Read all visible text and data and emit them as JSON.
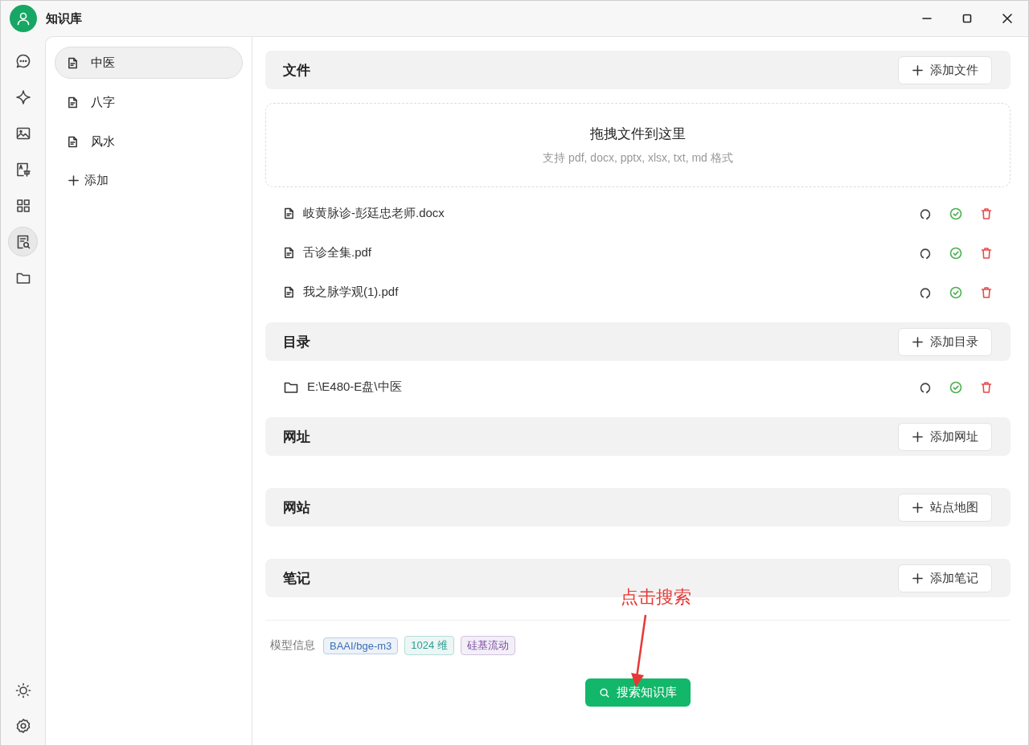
{
  "window": {
    "title": "知识库"
  },
  "rail": {
    "items": [
      {
        "kind": "chat",
        "selected": false
      },
      {
        "kind": "sparkle",
        "selected": false
      },
      {
        "kind": "image",
        "selected": false
      },
      {
        "kind": "translate",
        "selected": false
      },
      {
        "kind": "apps",
        "selected": false
      },
      {
        "kind": "knowledge",
        "selected": true
      },
      {
        "kind": "folder",
        "selected": false
      }
    ],
    "bottom": [
      {
        "kind": "theme"
      },
      {
        "kind": "settings"
      }
    ]
  },
  "knowledge_bases": {
    "items": [
      {
        "label": "中医",
        "selected": true
      },
      {
        "label": "八字",
        "selected": false
      },
      {
        "label": "风水",
        "selected": false
      }
    ],
    "add_label": "添加"
  },
  "sections": [
    {
      "title": "文件",
      "button": "添加文件",
      "dropzone": {
        "title": "拖拽文件到这里",
        "hint": "支持 pdf, docx, pptx, xlsx, txt, md 格式"
      },
      "items": [
        {
          "kind": "file",
          "name": "岐黄脉诊-彭廷忠老师.docx"
        },
        {
          "kind": "file",
          "name": "舌诊全集.pdf"
        },
        {
          "kind": "file",
          "name": "我之脉学观(1).pdf"
        }
      ]
    },
    {
      "title": "目录",
      "button": "添加目录",
      "items": [
        {
          "kind": "folder",
          "name": "E:\\E480-E盘\\中医"
        }
      ]
    },
    {
      "title": "网址",
      "button": "添加网址"
    },
    {
      "title": "网站",
      "button": "站点地图"
    },
    {
      "title": "笔记",
      "button": "添加笔记"
    }
  ],
  "model_info": {
    "label": "模型信息",
    "tags": [
      {
        "text": "BAAI/bge-m3",
        "color": "#3b6fb6"
      },
      {
        "text": "1024 维",
        "color": "#2a9d8f"
      },
      {
        "text": "硅基流动",
        "color": "#7b4fa6"
      }
    ]
  },
  "search_button": "搜索知识库",
  "annotation": {
    "text": "点击搜索"
  }
}
